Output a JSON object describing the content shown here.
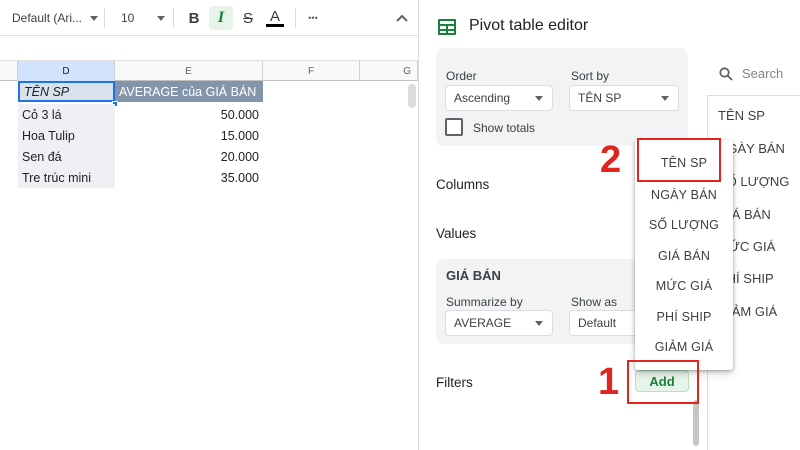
{
  "toolbar": {
    "font": "Default (Ari...",
    "size": "10",
    "bold": "B",
    "italic": "I",
    "strike": "S",
    "textColor": "A",
    "more": "•••",
    "collapse": "⌃"
  },
  "sheet": {
    "columns": [
      "D",
      "E",
      "F",
      "G"
    ],
    "header": {
      "label": "TÊN SP",
      "value": "AVERAGE của GIÁ BÁN"
    },
    "rows": [
      {
        "label": "Cỏ 3 lá",
        "value": "50.000"
      },
      {
        "label": "Hoa Tulip",
        "value": "15.000"
      },
      {
        "label": "Sen đá",
        "value": "20.000"
      },
      {
        "label": "Tre trúc mini",
        "value": "35.000"
      }
    ]
  },
  "editor": {
    "title": "Pivot table editor",
    "rowsCard": {
      "orderLabel": "Order",
      "orderValue": "Ascending",
      "sortByLabel": "Sort by",
      "sortByValue": "TÊN SP",
      "showTotals": "Show totals"
    },
    "columnsLabel": "Columns",
    "valuesLabel": "Values",
    "valueCard": {
      "field": "GIÁ BÁN",
      "summarizeLabel": "Summarize by",
      "summarizeValue": "AVERAGE",
      "showAsLabel": "Show as",
      "showAsValue": "Default"
    },
    "filtersLabel": "Filters",
    "addButton": "Add"
  },
  "search": {
    "placeholder": "Search"
  },
  "fieldList": [
    "TÊN SP",
    "NGÀY BÁN",
    "SỐ LƯỢNG",
    "GIÁ BÁN",
    "MỨC GIÁ",
    "PHÍ SHIP",
    "GIẢM GIÁ"
  ],
  "dropdown": [
    "TÊN SP",
    "NGÀY BÁN",
    "SỐ LƯỢNG",
    "GIÁ BÁN",
    "MỨC GIÁ",
    "PHÍ SHIP",
    "GIẢM GIÁ"
  ],
  "annotations": {
    "step1": "1",
    "step2": "2"
  },
  "colors": {
    "accent": "#1a73e8",
    "sheetsGreen": "#188038",
    "annotationRed": "#e0251f",
    "headerFill": "#8395ab"
  }
}
